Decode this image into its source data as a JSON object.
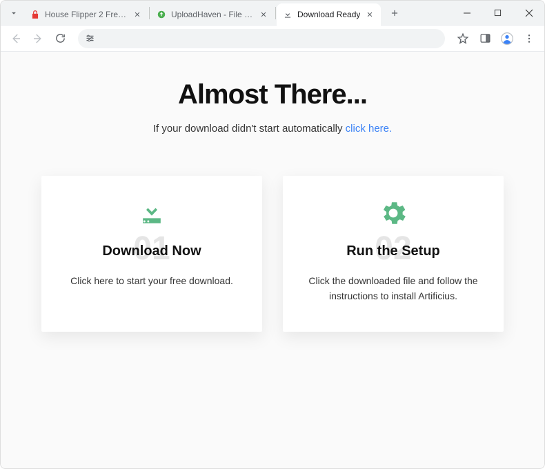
{
  "tabs": [
    {
      "title": "House Flipper 2 Free Downloa…",
      "favicon_color": "#e53935"
    },
    {
      "title": "UploadHaven - File Sharing Ma…",
      "favicon_color": "#4caf50"
    },
    {
      "title": "Download Ready",
      "favicon_color": "#5f6368",
      "active": true
    }
  ],
  "page": {
    "heading": "Almost There...",
    "subheading_text": "If your download didn't start automatically ",
    "subheading_link": "click here."
  },
  "cards": [
    {
      "number": "01",
      "title": "Download Now",
      "desc": "Click here to start your free download."
    },
    {
      "number": "02",
      "title": "Run the Setup",
      "desc": "Click the downloaded file and follow the instructions to install Artificius."
    }
  ]
}
